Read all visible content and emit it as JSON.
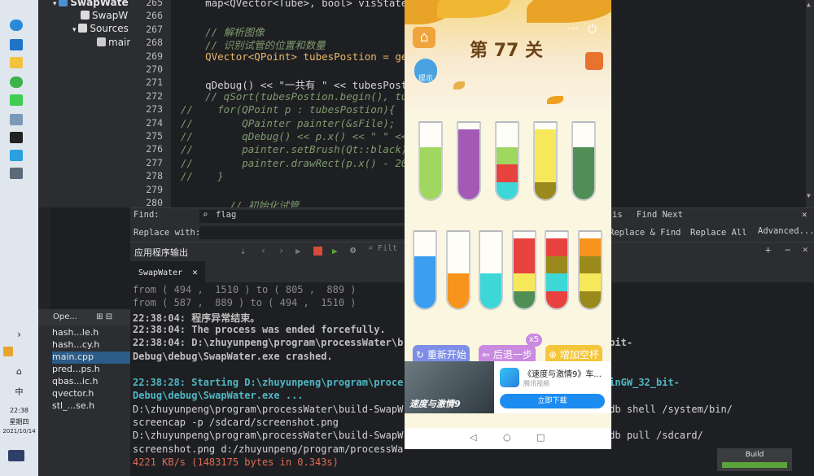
{
  "taskbar": {
    "clock_time": "22:38",
    "clock_day": "星期四",
    "clock_date": "2021/10/14",
    "ime": "中"
  },
  "tree": {
    "project": "SwapWate",
    "pro_file": "SwapW",
    "sources": "Sources",
    "main_file": "main"
  },
  "editor": {
    "lines": [
      {
        "n": "265",
        "t": "    map<QVector<Tube>, bool> visState;"
      },
      {
        "n": "266",
        "t": ""
      },
      {
        "n": "267",
        "t": "    // 解析图像"
      },
      {
        "n": "268",
        "t": "    // 识别试管的位置和数量"
      },
      {
        "n": "269",
        "t": "    QVector<QPoint> tubesPostion = ge"
      },
      {
        "n": "270",
        "t": ""
      },
      {
        "n": "271",
        "t": "    qDebug() << \"一共有 \" << tubesPost"
      },
      {
        "n": "272",
        "t": "    // qSort(tubesPostion.begin(), tu"
      },
      {
        "n": "273",
        "t": "//    for(QPoint p : tubesPostion){"
      },
      {
        "n": "274",
        "t": "//        QPainter painter(&sFile);"
      },
      {
        "n": "275",
        "t": "//        qDebug() << p.x() << \" \" <<"
      },
      {
        "n": "276",
        "t": "//        painter.setBrush(Qt::black)"
      },
      {
        "n": "277",
        "t": "//        painter.drawRect(p.x() - 20"
      },
      {
        "n": "278",
        "t": "//    }"
      },
      {
        "n": "279",
        "t": ""
      },
      {
        "n": "280",
        "t": "        // 初始化试管"
      }
    ]
  },
  "find": {
    "find_label": "Find:",
    "find_value": "flag",
    "replace_label": "Replace with:",
    "find_prev": "is",
    "find_next": "Find Next",
    "replace_find": "Replace & Find",
    "replace_all": "Replace All",
    "advanced": "Advanced..."
  },
  "output_panel": {
    "title": "应用程序输出",
    "filter_placeholder": "Filt",
    "tab": "SwapWater"
  },
  "output": {
    "lines": [
      {
        "t": "from ( 494 ,  1510 ) to ( 805 ,  889 )",
        "style": "dim"
      },
      {
        "t": "from ( 587 ,  889 ) to ( 494 ,  1510 )",
        "style": "dim"
      },
      {
        "t": "22:38:04: 程序异常结束。",
        "style": "bold"
      },
      {
        "t": "22:38:04: The process was ended forcefully.",
        "style": "bold"
      },
      {
        "t": "22:38:04: D:\\zhuyunpeng\\program\\processWater\\b                          MinGW_32_bit-",
        "style": "bold"
      },
      {
        "t": "Debug\\debug\\SwapWater.exe crashed.",
        "style": "bold"
      },
      {
        "t": "",
        "style": "dim"
      },
      {
        "t": "22:38:28: Starting D:\\zhuyunpeng\\program\\proce                          5_12_10_MinGW_32_bit-",
        "style": "cyan"
      },
      {
        "t": "Debug\\debug\\SwapWater.exe ...",
        "style": "cyan"
      },
      {
        "t": "D:\\zhuyunpeng\\program\\processWater\\build-SwapW                          t-Debug>adb shell /system/bin/",
        "style": "plain"
      },
      {
        "t": "screencap -p /sdcard/screenshot.png",
        "style": "plain"
      },
      {
        "t": "D:\\zhuyunpeng\\program\\processWater\\build-SwapW                          t-Debug>adb pull /sdcard/",
        "style": "plain"
      },
      {
        "t": "screenshot.png d:/zhuyunpeng/program/processWa",
        "style": "plain"
      },
      {
        "t": "4221 KB/s (1483175 bytes in 0.343s)",
        "style": "red"
      }
    ]
  },
  "open_docs": {
    "header": "Ope...",
    "items": [
      "hash...le.h",
      "hash...cy.h",
      "main.cpp",
      "pred...ps.h",
      "qbas...ic.h",
      "qvector.h",
      "stl_...se.h"
    ],
    "selected": "main.cpp"
  },
  "build": {
    "label": "Build",
    "progress": 1.0
  },
  "game": {
    "level": "第 77 关",
    "hint_label": "提示",
    "buttons": {
      "restart": "重新开始",
      "undo": "后退一步",
      "add_tube": "增加空杯"
    },
    "undo_count": "x5",
    "colors": {
      "green": "#9fd760",
      "purple": "#a45ab5",
      "red": "#e8423e",
      "cyan": "#3dd7d8",
      "yellow": "#f6e85a",
      "olive": "#9a8a1c",
      "darkgreen": "#4f8f55",
      "blue": "#3b9ef0",
      "orange": "#f7941d"
    },
    "tubes_row1": [
      [
        "green",
        "green",
        "green",
        "empty"
      ],
      [
        "purple",
        "purple",
        "purple",
        "purple"
      ],
      [
        "cyan",
        "red",
        "green",
        "empty"
      ],
      [
        "olive",
        "yellow",
        "yellow",
        "yellow"
      ],
      [
        "darkgreen",
        "darkgreen",
        "darkgreen",
        "empty"
      ]
    ],
    "tubes_row2": [
      [
        "blue",
        "blue",
        "blue",
        "empty"
      ],
      [
        "orange",
        "orange",
        "empty",
        "empty"
      ],
      [
        "cyan",
        "cyan",
        "empty",
        "empty"
      ],
      [
        "darkgreen",
        "yellow",
        "red",
        "red"
      ],
      [
        "red",
        "cyan",
        "olive",
        "red"
      ],
      [
        "olive",
        "yellow",
        "olive",
        "orange"
      ]
    ],
    "ad": {
      "title": "《速度与激情9》车...",
      "subtitle": "腾讯视频",
      "image_text": "速度与激情9",
      "download": "立即下载"
    },
    "nav": {
      "back": "◁",
      "home": "○",
      "recent": "□"
    }
  }
}
